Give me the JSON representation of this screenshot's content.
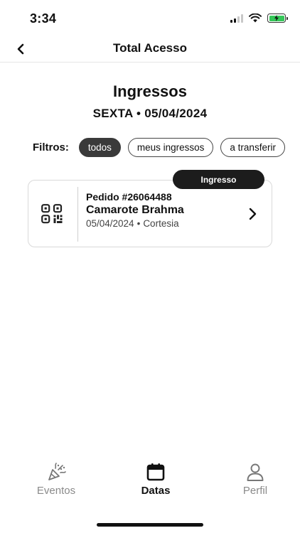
{
  "status_bar": {
    "time": "3:34",
    "icons": [
      "cellular-signal-icon",
      "wifi-icon",
      "battery-charging-icon"
    ],
    "battery_color": "#35c759"
  },
  "header": {
    "title": "Total Acesso",
    "back_icon": "chevron-left-icon"
  },
  "page": {
    "title": "Ingressos",
    "subtitle": "SEXTA • 05/04/2024"
  },
  "filters": {
    "label": "Filtros:",
    "options": [
      {
        "label": "todos",
        "active": true
      },
      {
        "label": "meus ingressos",
        "active": false
      },
      {
        "label": "a transferir",
        "active": false
      }
    ]
  },
  "ticket": {
    "badge": "Ingresso",
    "order": "Pedido #26064488",
    "event": "Camarote Brahma",
    "date": "05/04/2024",
    "separator": "•",
    "type": "Cortesia",
    "icon": "qr-code-icon",
    "action_icon": "chevron-right-icon"
  },
  "tab_bar": {
    "tabs": [
      {
        "label": "Eventos",
        "icon": "party-popper-icon",
        "active": false
      },
      {
        "label": "Datas",
        "icon": "calendar-icon",
        "active": true
      },
      {
        "label": "Perfil",
        "icon": "person-icon",
        "active": false
      }
    ]
  },
  "colors": {
    "active_chip": "#3a3a3a",
    "badge": "#1c1c1c",
    "inactive_tab": "#8a8a8a"
  }
}
